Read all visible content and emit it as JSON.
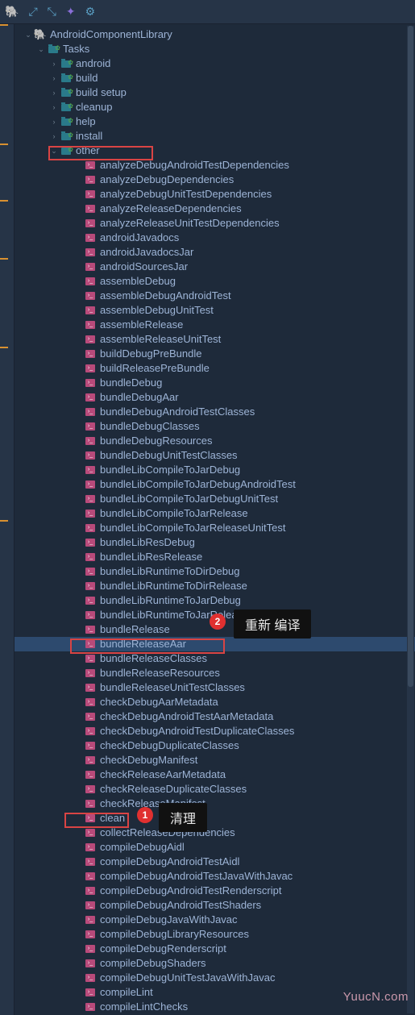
{
  "toolbar": {
    "icons": [
      "elephant",
      "expand",
      "collapse",
      "wand",
      "gear"
    ]
  },
  "tree": {
    "root": {
      "label": "AndroidComponentLibrary",
      "expanded": true
    },
    "tasks": {
      "label": "Tasks",
      "expanded": true
    },
    "groups": [
      {
        "label": "android",
        "expanded": false
      },
      {
        "label": "build",
        "expanded": false
      },
      {
        "label": "build setup",
        "expanded": false
      },
      {
        "label": "cleanup",
        "expanded": false
      },
      {
        "label": "help",
        "expanded": false
      },
      {
        "label": "install",
        "expanded": false
      },
      {
        "label": "other",
        "expanded": true
      }
    ],
    "other_tasks": [
      "analyzeDebugAndroidTestDependencies",
      "analyzeDebugDependencies",
      "analyzeDebugUnitTestDependencies",
      "analyzeReleaseDependencies",
      "analyzeReleaseUnitTestDependencies",
      "androidJavadocs",
      "androidJavadocsJar",
      "androidSourcesJar",
      "assembleDebug",
      "assembleDebugAndroidTest",
      "assembleDebugUnitTest",
      "assembleRelease",
      "assembleReleaseUnitTest",
      "buildDebugPreBundle",
      "buildReleasePreBundle",
      "bundleDebug",
      "bundleDebugAar",
      "bundleDebugAndroidTestClasses",
      "bundleDebugClasses",
      "bundleDebugResources",
      "bundleDebugUnitTestClasses",
      "bundleLibCompileToJarDebug",
      "bundleLibCompileToJarDebugAndroidTest",
      "bundleLibCompileToJarDebugUnitTest",
      "bundleLibCompileToJarRelease",
      "bundleLibCompileToJarReleaseUnitTest",
      "bundleLibResDebug",
      "bundleLibResRelease",
      "bundleLibRuntimeToDirDebug",
      "bundleLibRuntimeToDirRelease",
      "bundleLibRuntimeToJarDebug",
      "bundleLibRuntimeToJarRelease",
      "bundleRelease",
      "bundleReleaseAar",
      "bundleReleaseClasses",
      "bundleReleaseResources",
      "bundleReleaseUnitTestClasses",
      "checkDebugAarMetadata",
      "checkDebugAndroidTestAarMetadata",
      "checkDebugAndroidTestDuplicateClasses",
      "checkDebugDuplicateClasses",
      "checkDebugManifest",
      "checkReleaseAarMetadata",
      "checkReleaseDuplicateClasses",
      "checkReleaseManifest",
      "clean",
      "collectReleaseDependencies",
      "compileDebugAidl",
      "compileDebugAndroidTestAidl",
      "compileDebugAndroidTestJavaWithJavac",
      "compileDebugAndroidTestRenderscript",
      "compileDebugAndroidTestShaders",
      "compileDebugJavaWithJavac",
      "compileDebugLibraryResources",
      "compileDebugRenderscript",
      "compileDebugShaders",
      "compileDebugUnitTestJavaWithJavac",
      "compileLint",
      "compileLintChecks"
    ],
    "selected_task": "bundleReleaseAar"
  },
  "annotations": {
    "marker1": "1",
    "marker2": "2",
    "tooltip1": "清理",
    "tooltip2": "重新 编译"
  },
  "watermark": "YuucN.com",
  "colors": {
    "bg": "#1e2a3a",
    "panel": "#263447",
    "text": "#9db4d6",
    "folder": "#2a7a8a",
    "task": "#b84a7a",
    "red": "#d94444"
  }
}
